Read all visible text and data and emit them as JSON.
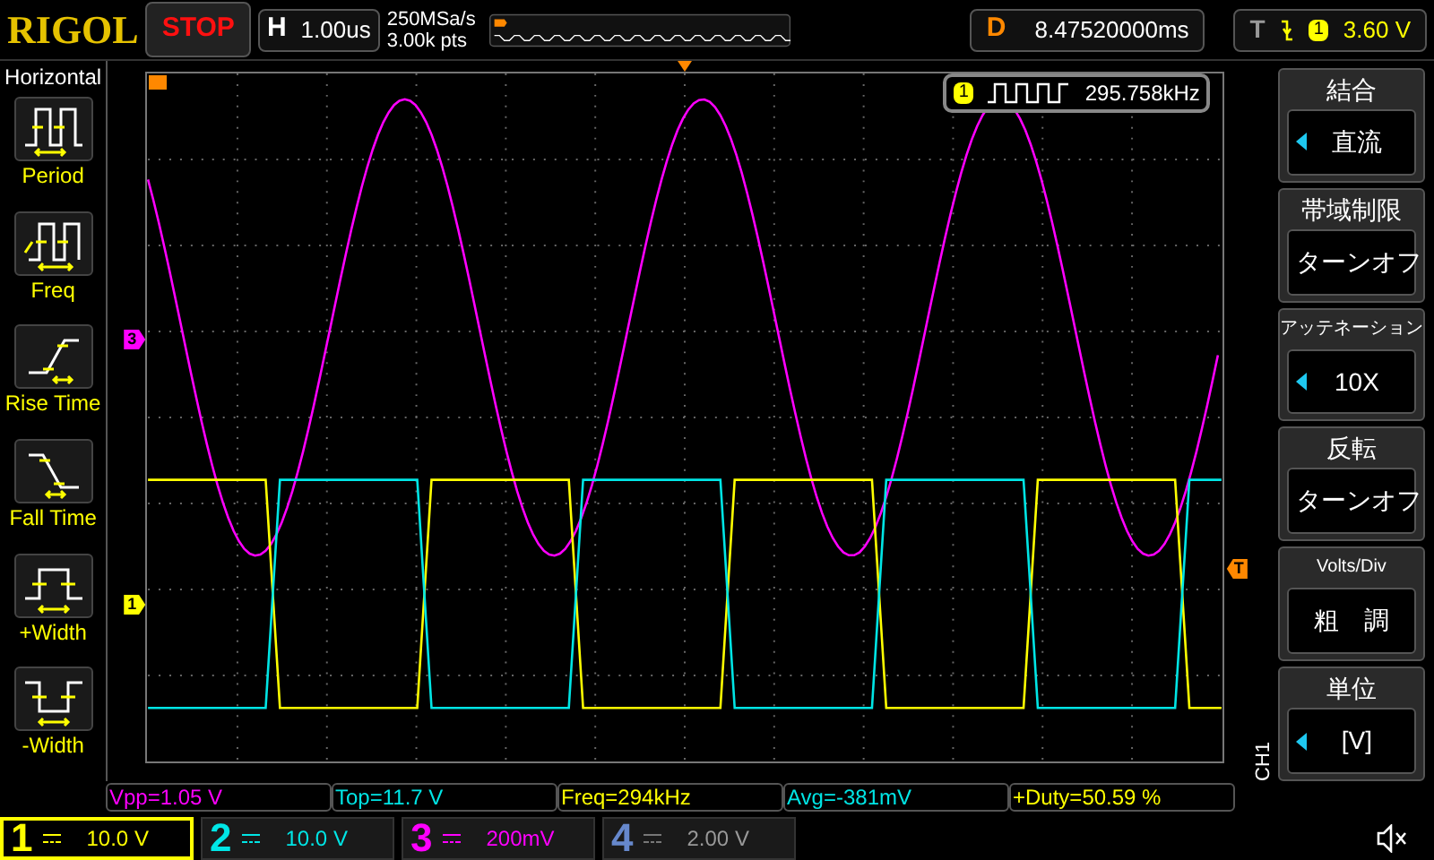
{
  "brand": "RIGOL",
  "run_status": "STOP",
  "horizontal": {
    "label": "H",
    "timebase": "1.00us"
  },
  "acquisition": {
    "sample_rate": "250MSa/s",
    "memory_depth": "3.00k pts"
  },
  "delay": {
    "label": "D",
    "value": "8.47520000ms"
  },
  "trigger": {
    "label": "T",
    "channel": "1",
    "level": "3.60 V"
  },
  "measure_menu": {
    "title": "Horizontal",
    "items": [
      {
        "label": "Period",
        "kind": "period"
      },
      {
        "label": "Freq",
        "kind": "freq"
      },
      {
        "label": "Rise Time",
        "kind": "rise"
      },
      {
        "label": "Fall Time",
        "kind": "fall"
      },
      {
        "label": "+Width",
        "kind": "pwidth"
      },
      {
        "label": "-Width",
        "kind": "nwidth"
      }
    ]
  },
  "frequency_counter": {
    "channel": "1",
    "value": "295.758kHz"
  },
  "level_markers": [
    {
      "text": "3",
      "color": "#ff00ff"
    },
    {
      "text": "1",
      "color": "#ffff00"
    }
  ],
  "trigger_marker": "T",
  "channel_menu": {
    "tab": "CH1",
    "items": [
      {
        "title": "結合",
        "value": "直流",
        "selectable": true
      },
      {
        "title": "帯域制限",
        "value": "ターンオフ",
        "selectable": false
      },
      {
        "title": "アッテネーション",
        "value": "10X",
        "selectable": true
      },
      {
        "title": "反転",
        "value": "ターンオフ",
        "selectable": false
      },
      {
        "title": "Volts/Div",
        "value": "粗　調",
        "selectable": false
      },
      {
        "title": "単位",
        "value": "[V]",
        "selectable": true
      }
    ]
  },
  "measurements": [
    {
      "text": "Vpp=1.05 V",
      "color": "#ff00ff"
    },
    {
      "text": "Top=11.7 V",
      "color": "#00e5e5"
    },
    {
      "text": "Freq=294kHz",
      "color": "#ffff00"
    },
    {
      "text": "Avg=-381mV",
      "color": "#00e5e5"
    },
    {
      "text": "+Duty=50.59 %",
      "color": "#ffff00"
    }
  ],
  "channels": [
    {
      "number": "1",
      "scale": "10.0 V",
      "color": "#ffff00",
      "on": true,
      "selected": true
    },
    {
      "number": "2",
      "scale": "10.0 V",
      "color": "#00e5e5",
      "on": true,
      "selected": false
    },
    {
      "number": "3",
      "scale": "200mV",
      "color": "#ff00ff",
      "on": true,
      "selected": false
    },
    {
      "number": "4",
      "scale": "2.00 V",
      "color": "#6688cc",
      "on": false,
      "selected": false
    }
  ]
}
